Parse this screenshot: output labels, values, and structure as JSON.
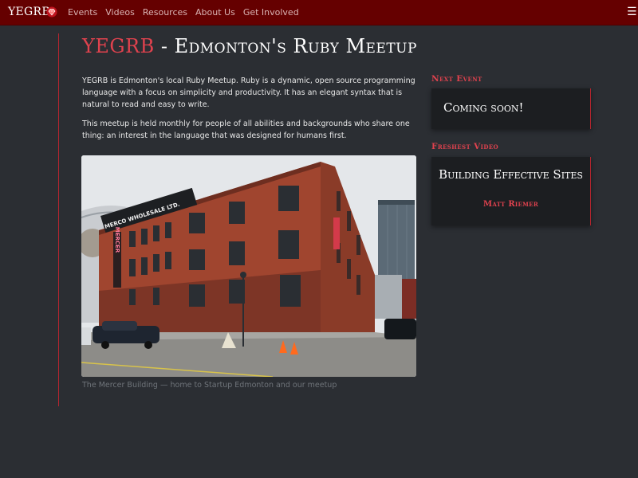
{
  "brand": {
    "name": "YEGRB",
    "logo_icon": "ruby-icon",
    "accent_color": "#e0424e",
    "nav_bg": "#650000"
  },
  "nav": [
    {
      "label": "Events"
    },
    {
      "label": "Videos"
    },
    {
      "label": "Resources"
    },
    {
      "label": "About Us"
    },
    {
      "label": "Get Involved"
    }
  ],
  "page": {
    "title_accent": "YEGRB",
    "title_rest": " - Edmonton's Ruby Meetup",
    "intro_1": "YEGRB is Edmonton's local Ruby Meetup. Ruby is a dynamic, open source programming language with a focus on simplicity and productivity. It has an elegant syntax that is natural to read and easy to write.",
    "intro_2": "This meetup is held monthly for people of all abilities and backgrounds who share one thing: an interest in the language that was designed for humans first.",
    "photo_caption": "The Mercer Building — home to Startup Edmonton and our meetup"
  },
  "photo_signs": {
    "wholesale": "MERCO WHOLESALE LTD.",
    "wholesale_sub": "MERCO WHOLESALE LTD. ",
    "vertical": "MERCER"
  },
  "sidebar": {
    "next_event_heading": "Next Event",
    "next_event_text": "Coming soon!",
    "freshest_video_heading": "Freshest Video",
    "video_title": "Building Effective Sites",
    "video_speaker": "Matt Riemer"
  }
}
